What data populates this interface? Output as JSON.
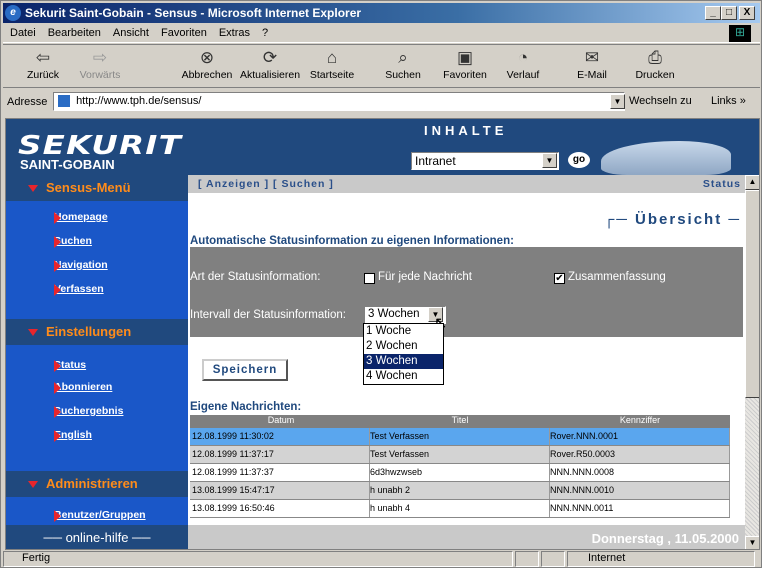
{
  "window": {
    "title": "Sekurit Saint-Gobain - Sensus - Microsoft Internet Explorer",
    "min": "_",
    "max": "□",
    "close": "X"
  },
  "menu": [
    "Datei",
    "Bearbeiten",
    "Ansicht",
    "Favoriten",
    "Extras",
    "?"
  ],
  "toolbar": {
    "back": "Zurück",
    "forward": "Vorwärts",
    "stop": "Abbrechen",
    "refresh": "Aktualisieren",
    "home": "Startseite",
    "search": "Suchen",
    "favorites": "Favoriten",
    "history": "Verlauf",
    "mail": "E-Mail",
    "print": "Drucken"
  },
  "address": {
    "label": "Adresse",
    "url": "http://www.tph.de/sensus/",
    "go": "Wechseln zu",
    "links": "Links »"
  },
  "header": {
    "logo_top": "SEKURIT",
    "logo_bottom": "SAINT-GOBAIN",
    "inhalte": "INHALTE",
    "select_value": "Intranet",
    "go": "go"
  },
  "sidebar": {
    "menu_title": "Sensus-Menü",
    "menu_items": [
      "Homepage",
      "Suchen",
      "Navigation",
      "Verfassen"
    ],
    "settings_title": "Einstellungen",
    "settings_items": [
      "Status",
      "Abonnieren",
      "Suchergebnis",
      "English"
    ],
    "admin_title": "Administrieren",
    "admin_items": [
      "Benutzer/Gruppen"
    ],
    "help": "online-hilfe"
  },
  "main": {
    "nav": "[ Anzeigen ] [ Suchen ]",
    "status": "Status",
    "overview": "Übersicht",
    "section1": "Automatische Statusinformation zu eigenen Informationen:",
    "type_label": "Art der Statusinformation:",
    "opt_each": "Für jede Nachricht",
    "opt_summary": "Zusammenfassung",
    "interval_label": "Intervall der Statusinformation:",
    "interval_value": "3 Wochen",
    "interval_options": [
      "1 Woche",
      "2 Wochen",
      "3 Wochen",
      "4 Wochen"
    ],
    "save": "Speichern",
    "section2": "Eigene Nachrichten:",
    "columns": [
      "Datum",
      "Titel",
      "Kennziffer"
    ],
    "rows": [
      [
        "12.08.1999 11:30:02",
        "Test Verfassen",
        "Rover.NNN.0001"
      ],
      [
        "12.08.1999 11:37:17",
        "Test Verfassen",
        "Rover.R50.0003"
      ],
      [
        "12.08.1999 11:37:37",
        "6d3hwzwseb",
        "NNN.NNN.0008"
      ],
      [
        "13.08.1999 15:47:17",
        "h unabh 2",
        "NNN.NNN.0010"
      ],
      [
        "13.08.1999 16:50:46",
        "h unabh 4",
        "NNN.NNN.0011"
      ]
    ],
    "footer_date": "Donnerstag , 11.05.2000"
  },
  "statusbar": {
    "text": "Fertig",
    "zone": "Internet"
  }
}
